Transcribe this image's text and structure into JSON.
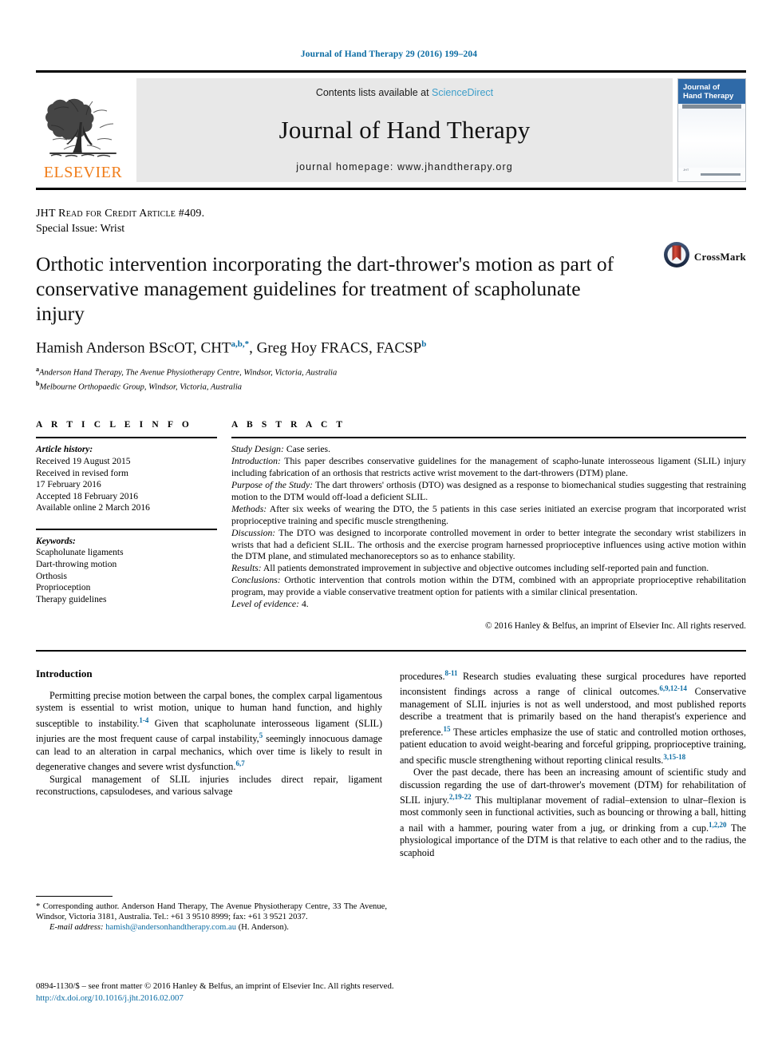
{
  "running_head": "Journal of Hand Therapy 29 (2016) 199–204",
  "masthead": {
    "publisher_name": "ELSEVIER",
    "contents_prefix": "Contents lists available at ",
    "contents_link": "ScienceDirect",
    "journal_title": "Journal of Hand Therapy",
    "homepage": "journal homepage: www.jhandtherapy.org",
    "cover": {
      "title_line1": "Journal of",
      "title_line2": "Hand Therapy",
      "footer_text": "JHT"
    }
  },
  "article_header": {
    "jht_line": "JHT Read for Credit Article #409.",
    "special_issue": "Special Issue: Wrist",
    "title": "Orthotic intervention incorporating the dart-thrower's motion as part of conservative management guidelines for treatment of scapholunate injury",
    "author1_name": "Hamish Anderson BScOT, CHT",
    "author1_sup": "a,b,*",
    "author_separator": ", ",
    "author2_name": "Greg Hoy FRACS, FACSP",
    "author2_sup": "b",
    "affiliation_a_sup": "a",
    "affiliation_a": "Anderson Hand Therapy, The Avenue Physiotherapy Centre, Windsor, Victoria, Australia",
    "affiliation_b_sup": "b",
    "affiliation_b": "Melbourne Orthopaedic Group, Windsor, Victoria, Australia",
    "crossmark_label": "CrossMark"
  },
  "article_info": {
    "heading": "A R T I C L E  I N F O",
    "history_label": "Article history:",
    "history_lines": [
      "Received 19 August 2015",
      "Received in revised form",
      "17 February 2016",
      "Accepted 18 February 2016",
      "Available online 2 March 2016"
    ],
    "keywords_label": "Keywords:",
    "keywords": [
      "Scapholunate ligaments",
      "Dart-throwing motion",
      "Orthosis",
      "Proprioception",
      "Therapy guidelines"
    ]
  },
  "abstract": {
    "heading": "A B S T R A C T",
    "sections": [
      {
        "label": "Study Design:",
        "text": " Case series."
      },
      {
        "label": "Introduction:",
        "text": " This paper describes conservative guidelines for the management of scapho-lunate interosseous ligament (SLIL) injury including fabrication of an orthosis that restricts active wrist movement to the dart-throwers (DTM) plane."
      },
      {
        "label": "Purpose of the Study:",
        "text": " The dart throwers' orthosis (DTO) was designed as a response to biomechanical studies suggesting that restraining motion to the DTM would off-load a deficient SLIL."
      },
      {
        "label": "Methods:",
        "text": " After six weeks of wearing the DTO, the 5 patients in this case series initiated an exercise program that incorporated wrist proprioceptive training and specific muscle strengthening."
      },
      {
        "label": "Discussion:",
        "text": " The DTO was designed to incorporate controlled movement in order to better integrate the secondary wrist stabilizers in wrists that had a deficient SLIL. The orthosis and the exercise program harnessed proprioceptive influences using active motion within the DTM plane, and stimulated mechanoreceptors so as to enhance stability."
      },
      {
        "label": "Results:",
        "text": " All patients demonstrated improvement in subjective and objective outcomes including self-reported pain and function."
      },
      {
        "label": "Conclusions:",
        "text": " Orthotic intervention that controls motion within the DTM, combined with an appropriate proprioceptive rehabilitation program, may provide a viable conservative treatment option for patients with a similar clinical presentation."
      },
      {
        "label": "Level of evidence:",
        "text": " 4."
      }
    ],
    "copyright": "© 2016 Hanley & Belfus, an imprint of Elsevier Inc. All rights reserved."
  },
  "body": {
    "section_heading": "Introduction",
    "left_paragraphs": [
      "Permitting precise motion between the carpal bones, the complex carpal ligamentous system is essential to wrist motion, unique to human hand function, and highly susceptible to instability.||1-4|| Given that scapholunate interosseous ligament (SLIL) injuries are the most frequent cause of carpal instability,||5|| seemingly innocuous damage can lead to an alteration in carpal mechanics, which over time is likely to result in degenerative changes and severe wrist dysfunction.||6,7||",
      "Surgical management of SLIL injuries includes direct repair, ligament reconstructions, capsulodeses, and various salvage"
    ],
    "right_paragraphs": [
      "procedures.||8-11|| Research studies evaluating these surgical procedures have reported inconsistent findings across a range of clinical outcomes.||6,9,12-14|| Conservative management of SLIL injuries is not as well understood, and most published reports describe a treatment that is primarily based on the hand therapist's experience and preference.||15|| These articles emphasize the use of static and controlled motion orthoses, patient education to avoid weight-bearing and forceful gripping, proprioceptive training, and specific muscle strengthening without reporting clinical results.||3,15-18||",
      "Over the past decade, there has been an increasing amount of scientific study and discussion regarding the use of dart-thrower's movement (DTM) for rehabilitation of SLIL injury.||2,19-22|| This multiplanar movement of radial–extension to ulnar–flexion is most commonly seen in functional activities, such as bouncing or throwing a ball, hitting a nail with a hammer, pouring water from a jug, or drinking from a cup.||1,2,20|| The physiological importance of the DTM is that relative to each other and to the radius, the scaphoid"
    ]
  },
  "footnotes": {
    "corresponding": "* Corresponding author. Anderson Hand Therapy, The Avenue Physiotherapy Centre, 33 The Avenue, Windsor, Victoria 3181, Australia. Tel.: +61 3 9510 8999; fax: +61 3 9521 2037.",
    "email_label": "E-mail address:",
    "email": "hamish@andersonhandtherapy.com.au",
    "email_suffix": " (H. Anderson).",
    "issn_line": "0894-1130/$ – see front matter © 2016 Hanley & Belfus, an imprint of Elsevier Inc. All rights reserved.",
    "doi": "http://dx.doi.org/10.1016/j.jht.2016.02.007"
  },
  "colors": {
    "link_blue": "#0b6ca3",
    "sciencedirect_blue": "#3d9ec9",
    "elsevier_orange": "#f07d1a",
    "crossmark_navy": "#1f3a5f",
    "crossmark_red": "#c0392b",
    "cover_blue": "#2f6aa8"
  }
}
